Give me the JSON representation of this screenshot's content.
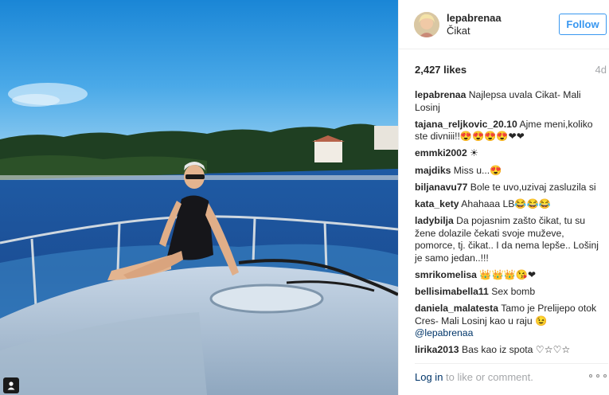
{
  "post": {
    "owner": "lepabrenaa",
    "location": "Čikat",
    "follow_label": "Follow",
    "likes": "2,427 likes",
    "time_ago": "4d"
  },
  "comments": [
    {
      "user": "lepabrenaa",
      "text": "Najlepsa uvala Cikat- Mali Losinj"
    },
    {
      "user": "tajana_reljkovic_20.10",
      "text": "Ajme meni,koliko ste divniii!!😍😍😍😍❤❤"
    },
    {
      "user": "emmki2002",
      "text": "☀"
    },
    {
      "user": "majdiks",
      "text": "Miss u...😍"
    },
    {
      "user": "biljanavu77",
      "text": "Bole te uvo,uzivaj zasluzila si"
    },
    {
      "user": "kata_kety",
      "text": "Ahahaaa LB😂😂😂"
    },
    {
      "user": "ladybilja",
      "text": "Da pojasnim zašto čikat, tu su žene dolazile čekati svoje muževe, pomorce, tj. čikat.. I da nema lepše.. Lošinj je samo jedan..!!!"
    },
    {
      "user": "smrikomelisa",
      "text": "👑👑👑😘❤"
    },
    {
      "user": "bellisimabella11",
      "text": "Sex bomb"
    },
    {
      "user": "daniela_malatesta",
      "text": "Tamo je Prelijepo otok Cres- Mali Losinj kao u raju 😉",
      "mention": "@lepabrenaa"
    },
    {
      "user": "lirika2013",
      "text": "Bas kao iz spota ♡☆♡☆"
    }
  ],
  "footer": {
    "login_label": "Log in",
    "suffix": " to like or comment."
  },
  "icons": {
    "more": "more-options-icon",
    "user_tag": "user-tag-icon"
  },
  "colors": {
    "accent": "#3897f0",
    "link": "#003569",
    "muted": "#a5a7aa"
  }
}
